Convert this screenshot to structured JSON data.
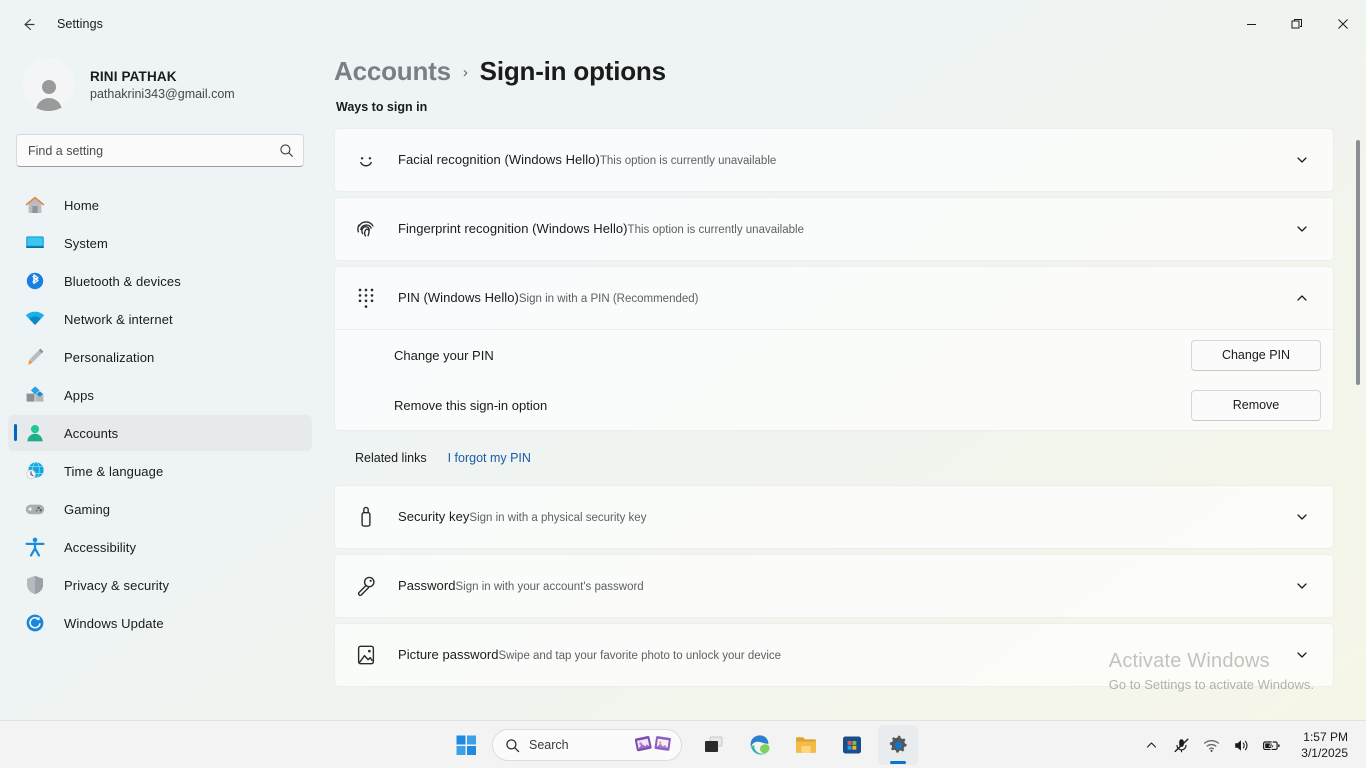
{
  "window": {
    "titlebar_title": "Settings",
    "back_icon": "back-arrow-icon",
    "minimize_icon": "minimize-icon",
    "restore_icon": "restore-icon",
    "close_icon": "close-icon"
  },
  "sidebar": {
    "account": {
      "name": "RINI PATHAK",
      "email": "pathakrini343@gmail.com",
      "avatar_icon": "user-avatar-icon"
    },
    "search": {
      "placeholder": "Find a setting",
      "value": "",
      "icon": "search-icon"
    },
    "items": [
      {
        "label": "Home",
        "icon": "home-icon",
        "selected": false
      },
      {
        "label": "System",
        "icon": "system-icon",
        "selected": false
      },
      {
        "label": "Bluetooth & devices",
        "icon": "bluetooth-icon",
        "selected": false
      },
      {
        "label": "Network & internet",
        "icon": "network-icon",
        "selected": false
      },
      {
        "label": "Personalization",
        "icon": "personalization-icon",
        "selected": false
      },
      {
        "label": "Apps",
        "icon": "apps-icon",
        "selected": false
      },
      {
        "label": "Accounts",
        "icon": "accounts-icon",
        "selected": true
      },
      {
        "label": "Time & language",
        "icon": "time-language-icon",
        "selected": false
      },
      {
        "label": "Gaming",
        "icon": "gaming-icon",
        "selected": false
      },
      {
        "label": "Accessibility",
        "icon": "accessibility-icon",
        "selected": false
      },
      {
        "label": "Privacy & security",
        "icon": "privacy-icon",
        "selected": false
      },
      {
        "label": "Windows Update",
        "icon": "windows-update-icon",
        "selected": false
      }
    ]
  },
  "main": {
    "breadcrumb_parent": "Accounts",
    "breadcrumb_separator": "›",
    "breadcrumb_current": "Sign-in options",
    "section_title": "Ways to sign in",
    "cards": [
      {
        "title": "Facial recognition (Windows Hello)",
        "subtitle": "This option is currently unavailable",
        "icon": "face-icon",
        "expanded": false,
        "chevron": "chevron-down-icon"
      },
      {
        "title": "Fingerprint recognition (Windows Hello)",
        "subtitle": "This option is currently unavailable",
        "icon": "fingerprint-icon",
        "expanded": false,
        "chevron": "chevron-down-icon"
      },
      {
        "title": "PIN (Windows Hello)",
        "subtitle": "Sign in with a PIN (Recommended)",
        "icon": "pin-keypad-icon",
        "expanded": true,
        "chevron": "chevron-up-icon",
        "rows": [
          {
            "label": "Change your PIN",
            "button": "Change PIN"
          },
          {
            "label": "Remove this sign-in option",
            "button": "Remove"
          }
        ]
      },
      {
        "title": "Security key",
        "subtitle": "Sign in with a physical security key",
        "icon": "usb-security-key-icon",
        "expanded": false,
        "chevron": "chevron-down-icon"
      },
      {
        "title": "Password",
        "subtitle": "Sign in with your account's password",
        "icon": "key-icon",
        "expanded": false,
        "chevron": "chevron-down-icon"
      },
      {
        "title": "Picture password",
        "subtitle": "Swipe and tap your favorite photo to unlock your device",
        "icon": "picture-password-icon",
        "expanded": false,
        "chevron": "chevron-down-icon"
      }
    ],
    "related_links_label": "Related links",
    "forgot_pin_link": "I forgot my PIN"
  },
  "watermark": {
    "title": "Activate Windows",
    "subtitle": "Go to Settings to activate Windows."
  },
  "taskbar": {
    "start_icon": "windows-start-icon",
    "search": {
      "label": "Search",
      "icon": "search-icon"
    },
    "buttons": [
      {
        "name": "task-view-button",
        "icon": "task-view-icon",
        "active": false
      },
      {
        "name": "edge-button",
        "icon": "edge-icon",
        "active": false
      },
      {
        "name": "file-explorer-button",
        "icon": "file-explorer-icon",
        "active": false
      },
      {
        "name": "microsoft-store-button",
        "icon": "microsoft-store-icon",
        "active": false
      },
      {
        "name": "settings-button",
        "icon": "settings-gear-icon",
        "active": true
      }
    ],
    "tray": [
      {
        "name": "show-hidden-icons-button",
        "icon": "chevron-up-icon"
      },
      {
        "name": "microphone-muted-button",
        "icon": "microphone-muted-icon"
      },
      {
        "name": "wifi-button",
        "icon": "wifi-icon"
      },
      {
        "name": "volume-button",
        "icon": "volume-icon"
      },
      {
        "name": "battery-button",
        "icon": "battery-charging-icon"
      }
    ],
    "clock": {
      "time": "1:57 PM",
      "date": "3/1/2025"
    }
  },
  "colors": {
    "accent": "#0067c0",
    "link": "#1a5ca8",
    "selected_nav_bg": "#e7eaec"
  }
}
